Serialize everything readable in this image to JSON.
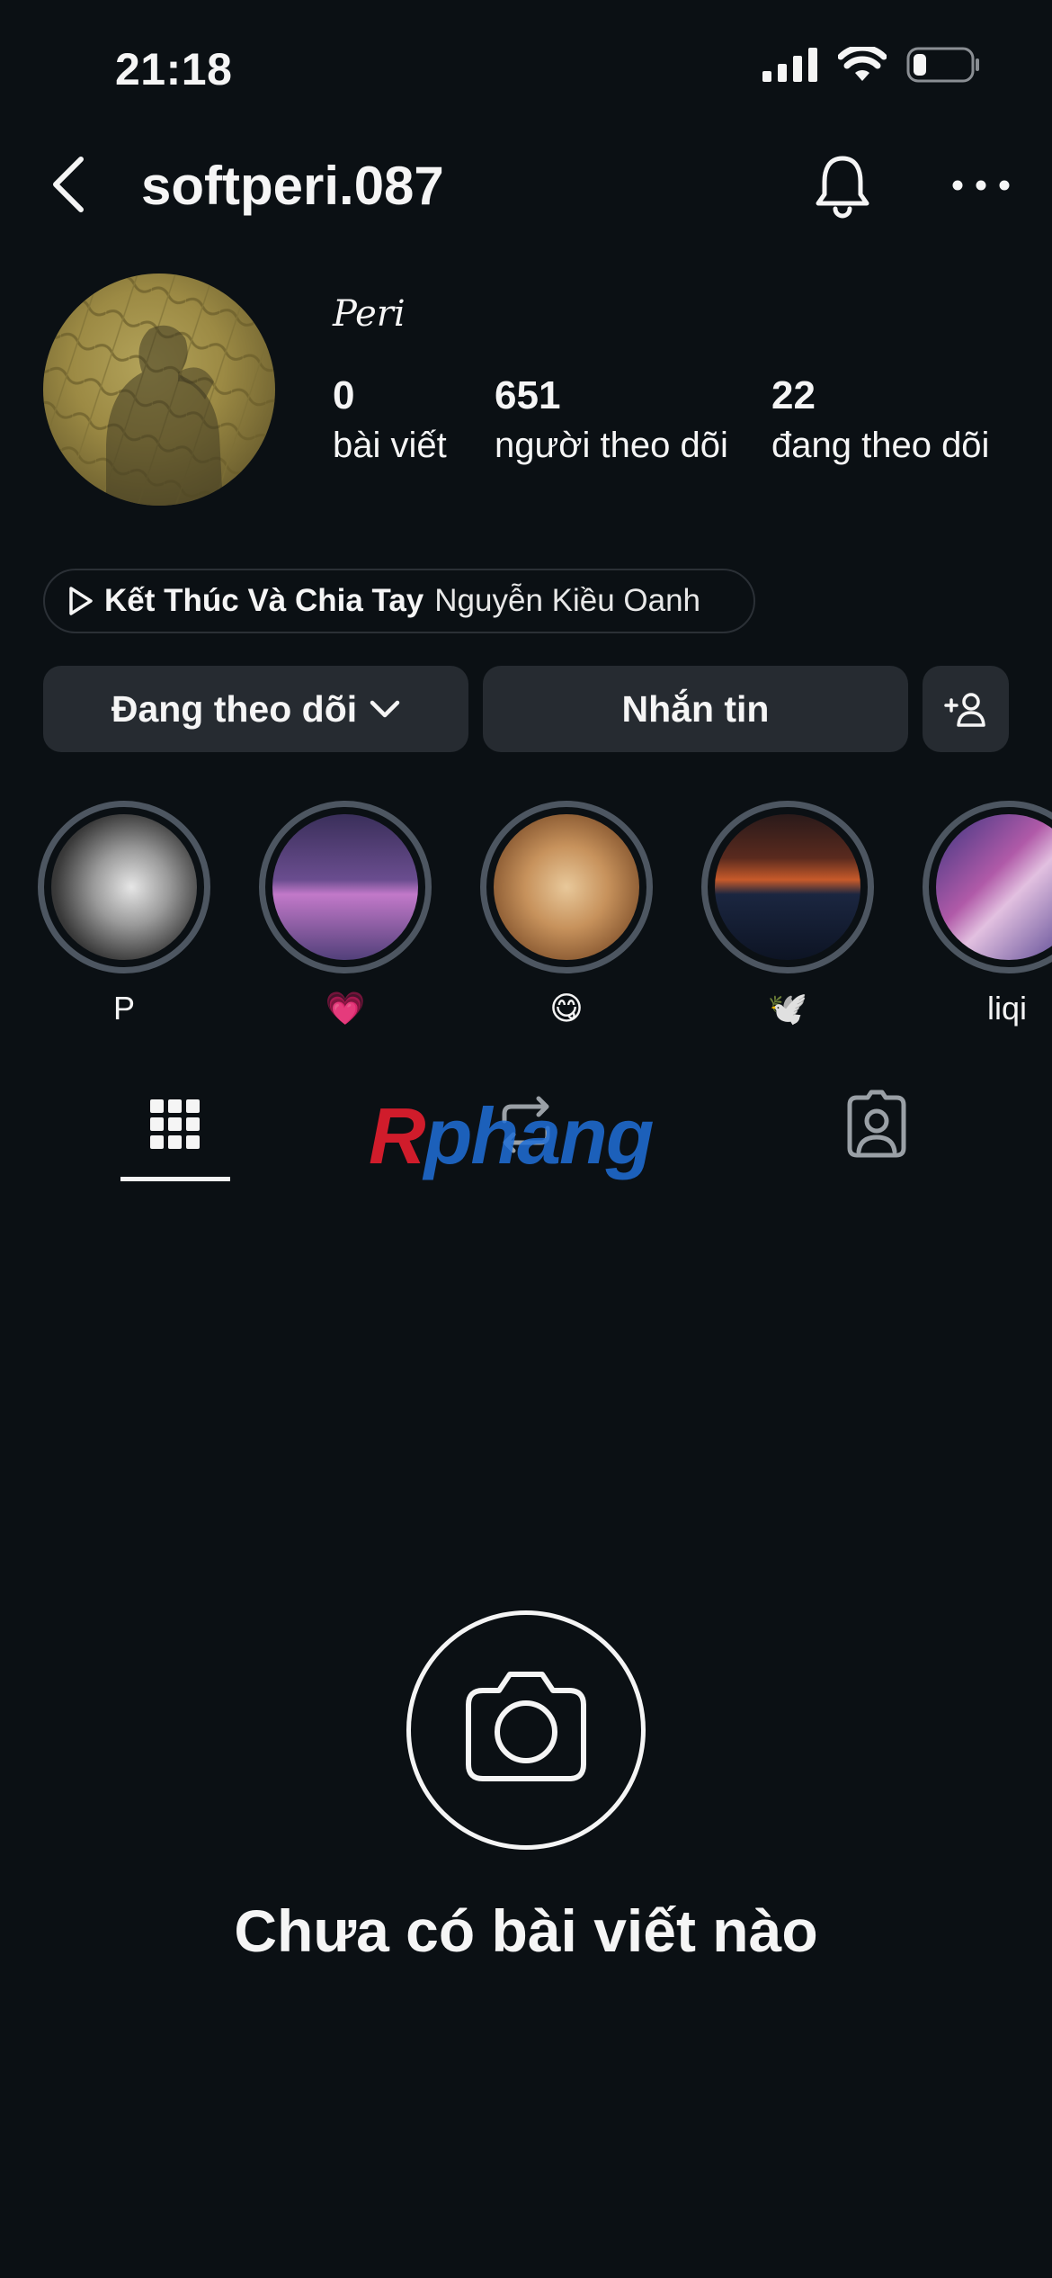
{
  "status_bar": {
    "time": "21:18",
    "icons": [
      "cellular-signal-icon",
      "wifi-icon",
      "battery-icon"
    ]
  },
  "header": {
    "username": "softperi.087",
    "icons": [
      "back-arrow-icon",
      "bell-icon",
      "more-icon"
    ]
  },
  "profile": {
    "display_name": "Peri",
    "stats": [
      {
        "value": "0",
        "label": "bài viết"
      },
      {
        "value": "651",
        "label": "người theo dõi"
      },
      {
        "value": "22",
        "label": "đang theo dõi"
      }
    ]
  },
  "music": {
    "song": "Kết Thúc Và Chia Tay",
    "artist": "Nguyễn Kiều Oanh"
  },
  "actions": {
    "following_label": "Đang theo dõi",
    "message_label": "Nhắn tin"
  },
  "highlights": [
    {
      "label": "P"
    },
    {
      "label": "💗"
    },
    {
      "label": "😋"
    },
    {
      "label": "🕊️"
    },
    {
      "label": "liqi"
    }
  ],
  "tabs": [
    "grid-icon",
    "reposts-icon",
    "tagged-icon"
  ],
  "watermark": {
    "first": "R",
    "rest": "phang"
  },
  "empty_state": {
    "text": "Chưa có bài viết nào"
  },
  "colors": {
    "background": "#0b1014",
    "button": "#262b31",
    "highlight_ring": "#4d5661",
    "text": "#f5f5f5"
  }
}
